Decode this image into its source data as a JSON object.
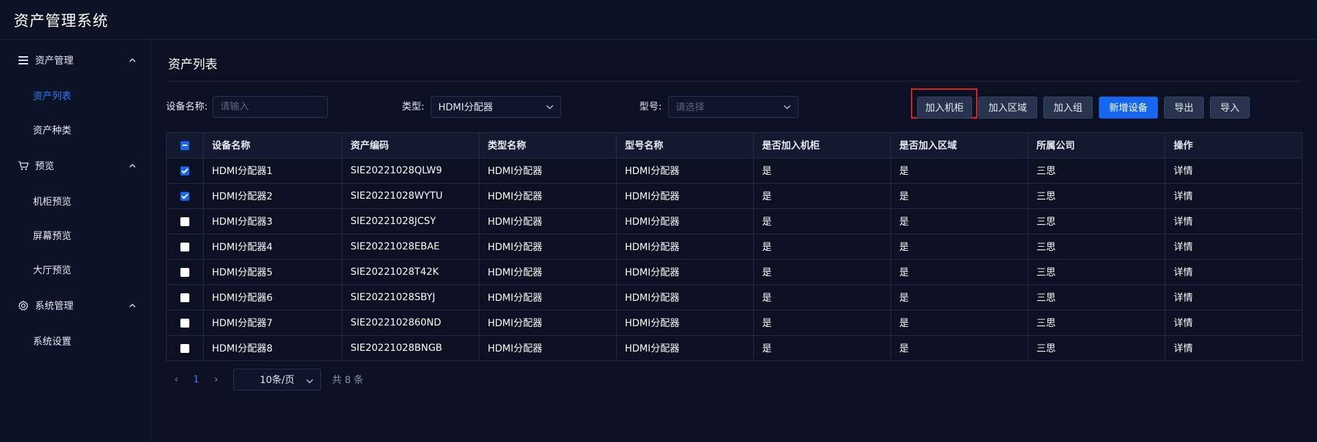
{
  "app": {
    "title": "资产管理系统"
  },
  "sidebar": {
    "groups": [
      {
        "label": "资产管理",
        "icon": "menu-icon",
        "items": [
          {
            "label": "资产列表",
            "active": true
          },
          {
            "label": "资产种类",
            "active": false
          }
        ]
      },
      {
        "label": "预览",
        "icon": "cart-icon",
        "items": [
          {
            "label": "机柜预览"
          },
          {
            "label": "屏幕预览"
          },
          {
            "label": "大厅预览"
          }
        ]
      },
      {
        "label": "系统管理",
        "icon": "gear-icon",
        "items": [
          {
            "label": "系统设置"
          }
        ]
      }
    ]
  },
  "main": {
    "title": "资产列表",
    "filters": {
      "device_name_label": "设备名称:",
      "device_name_placeholder": "请输入",
      "type_label": "类型:",
      "type_value": "HDMI分配器",
      "model_label": "型号:",
      "model_placeholder": "请选择"
    },
    "buttons": {
      "add_cabinet": "加入机柜",
      "add_area": "加入区域",
      "add_group": "加入组",
      "new_device": "新增设备",
      "export": "导出",
      "import": "导入"
    },
    "table": {
      "headers": [
        "设备名称",
        "资产编码",
        "类型名称",
        "型号名称",
        "是否加入机柜",
        "是否加入区域",
        "所属公司",
        "操作"
      ],
      "rows": [
        {
          "checked": true,
          "name": "HDMI分配器1",
          "code": "SIE20221028QLW9",
          "type": "HDMI分配器",
          "model": "HDMI分配器",
          "cabinet": "是",
          "area": "是",
          "company": "三思",
          "action": "详情"
        },
        {
          "checked": true,
          "name": "HDMI分配器2",
          "code": "SIE20221028WYTU",
          "type": "HDMI分配器",
          "model": "HDMI分配器",
          "cabinet": "是",
          "area": "是",
          "company": "三思",
          "action": "详情"
        },
        {
          "checked": false,
          "name": "HDMI分配器3",
          "code": "SIE20221028JCSY",
          "type": "HDMI分配器",
          "model": "HDMI分配器",
          "cabinet": "是",
          "area": "是",
          "company": "三思",
          "action": "详情"
        },
        {
          "checked": false,
          "name": "HDMI分配器4",
          "code": "SIE20221028EBAE",
          "type": "HDMI分配器",
          "model": "HDMI分配器",
          "cabinet": "是",
          "area": "是",
          "company": "三思",
          "action": "详情"
        },
        {
          "checked": false,
          "name": "HDMI分配器5",
          "code": "SIE20221028T42K",
          "type": "HDMI分配器",
          "model": "HDMI分配器",
          "cabinet": "是",
          "area": "是",
          "company": "三思",
          "action": "详情"
        },
        {
          "checked": false,
          "name": "HDMI分配器6",
          "code": "SIE20221028SBYJ",
          "type": "HDMI分配器",
          "model": "HDMI分配器",
          "cabinet": "是",
          "area": "是",
          "company": "三思",
          "action": "详情"
        },
        {
          "checked": false,
          "name": "HDMI分配器7",
          "code": "SIE2022102860ND",
          "type": "HDMI分配器",
          "model": "HDMI分配器",
          "cabinet": "是",
          "area": "是",
          "company": "三思",
          "action": "详情"
        },
        {
          "checked": false,
          "name": "HDMI分配器8",
          "code": "SIE20221028BNGB",
          "type": "HDMI分配器",
          "model": "HDMI分配器",
          "cabinet": "是",
          "area": "是",
          "company": "三思",
          "action": "详情"
        }
      ]
    },
    "pagination": {
      "prev": "‹",
      "current_page": "1",
      "next": "›",
      "page_size": "10条/页",
      "total": "共 8 条"
    }
  },
  "colors": {
    "accent": "#1766ef",
    "link": "#2f7df6",
    "background": "#0b1023",
    "highlight": "#e52222"
  }
}
